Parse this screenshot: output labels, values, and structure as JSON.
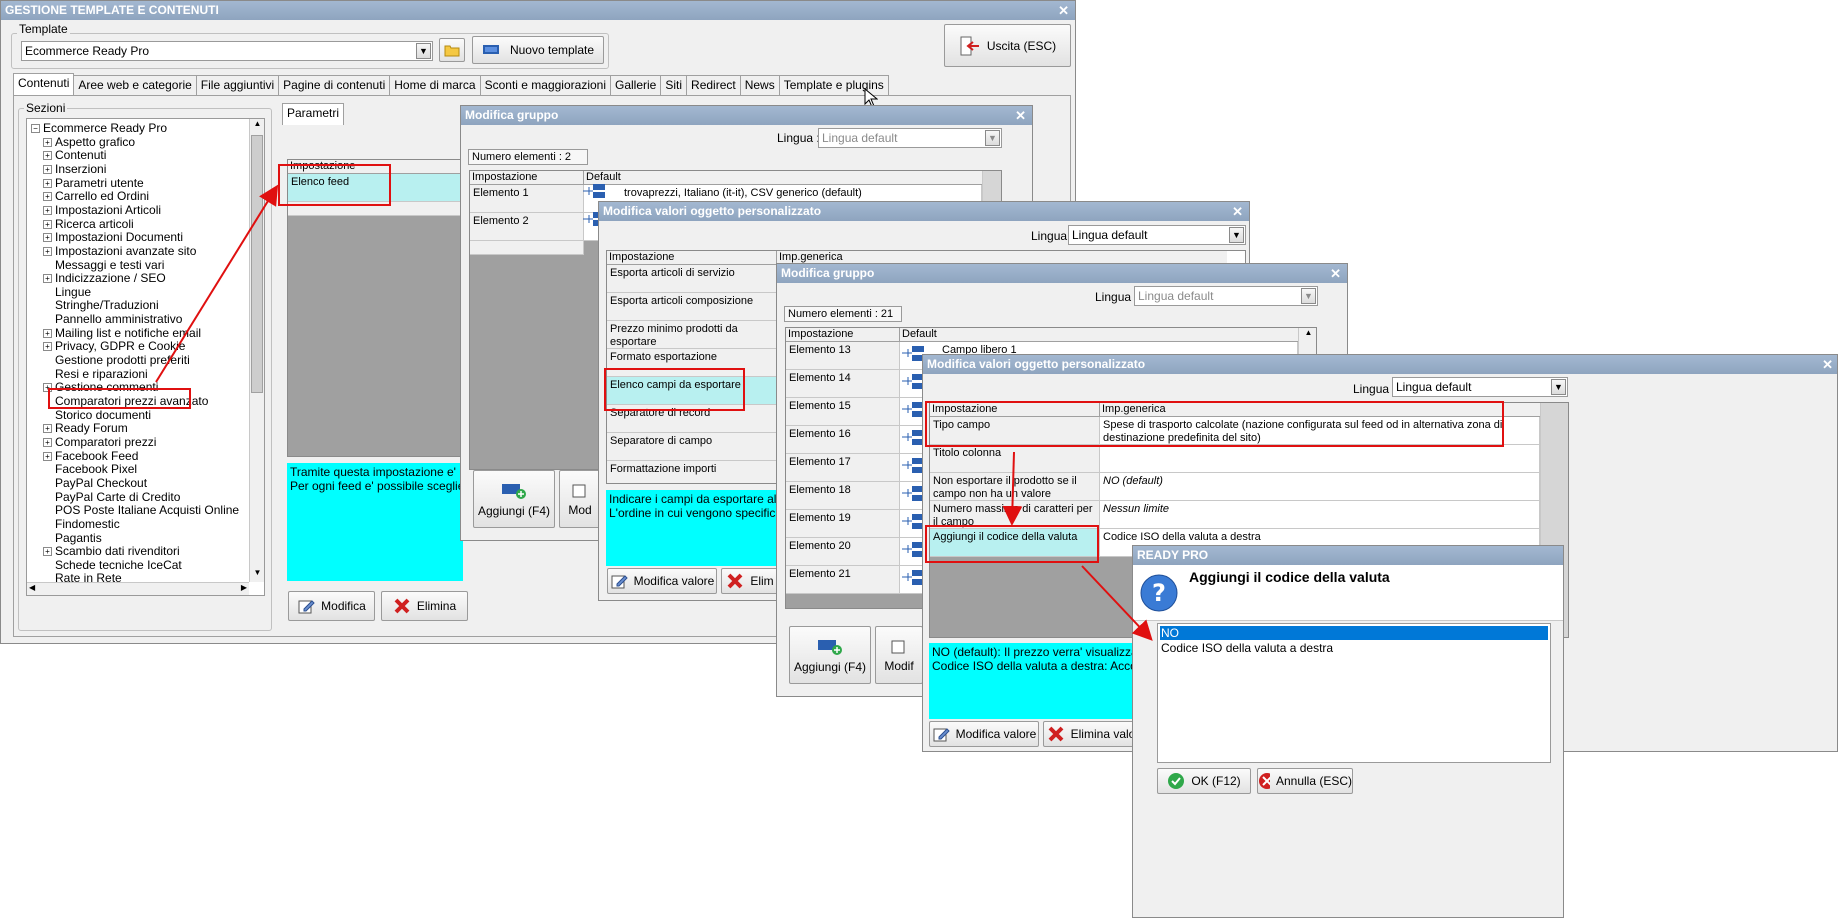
{
  "main_window": {
    "title": "GESTIONE TEMPLATE E CONTENUTI",
    "template_label": "Template",
    "template_value": "Ecommerce Ready Pro",
    "new_template_label": "Nuovo template",
    "exit_label": "Uscita (ESC)",
    "tabs": [
      "Contenuti",
      "Aree web e categorie",
      "File aggiuntivi",
      "Pagine di contenuti",
      "Home di marca",
      "Sconti e maggiorazioni",
      "Gallerie",
      "Siti",
      "Redirect",
      "News",
      "Template e plugins"
    ],
    "sections_label": "Sezioni",
    "tree_root": "Ecommerce Ready Pro",
    "tree_items": [
      {
        "label": "Aspetto grafico",
        "expandable": true
      },
      {
        "label": "Contenuti",
        "expandable": true
      },
      {
        "label": "Inserzioni",
        "expandable": true
      },
      {
        "label": "Parametri utente",
        "expandable": true
      },
      {
        "label": "Carrello ed Ordini",
        "expandable": true
      },
      {
        "label": "Impostazioni Articoli",
        "expandable": true
      },
      {
        "label": "Ricerca articoli",
        "expandable": true
      },
      {
        "label": "Impostazioni Documenti",
        "expandable": true
      },
      {
        "label": "Impostazioni avanzate sito",
        "expandable": true
      },
      {
        "label": "Messaggi e testi vari",
        "expandable": false
      },
      {
        "label": "Indicizzazione / SEO",
        "expandable": true
      },
      {
        "label": "Lingue",
        "expandable": false
      },
      {
        "label": "Stringhe/Traduzioni",
        "expandable": false
      },
      {
        "label": "Pannello amministrativo",
        "expandable": false
      },
      {
        "label": "Mailing list e notifiche email",
        "expandable": true
      },
      {
        "label": "Privacy, GDPR e Cookie",
        "expandable": true
      },
      {
        "label": "Gestione prodotti preferiti",
        "expandable": false
      },
      {
        "label": "Resi e riparazioni",
        "expandable": false
      },
      {
        "label": "Gestione commenti",
        "expandable": true
      },
      {
        "label": "Comparatori prezzi avanzato",
        "expandable": false
      },
      {
        "label": "Storico documenti",
        "expandable": false
      },
      {
        "label": "Ready Forum",
        "expandable": true
      },
      {
        "label": "Comparatori prezzi",
        "expandable": true
      },
      {
        "label": "Facebook Feed",
        "expandable": true
      },
      {
        "label": "Facebook Pixel",
        "expandable": false
      },
      {
        "label": "PayPal Checkout",
        "expandable": false
      },
      {
        "label": "PayPal Carte di Credito",
        "expandable": false
      },
      {
        "label": "POS Poste Italiane Acquisti Online",
        "expandable": false
      },
      {
        "label": "Findomestic",
        "expandable": false
      },
      {
        "label": "Pagantis",
        "expandable": false
      },
      {
        "label": "Scambio dati rivenditori",
        "expandable": true
      },
      {
        "label": "Schede tecniche IceCat",
        "expandable": false
      },
      {
        "label": "Rate in Rete",
        "expandable": false
      }
    ],
    "params_tab": "Parametri",
    "grid_header": "Impostazione",
    "grid_row": "Elenco feed",
    "description": "Tramite questa impostazione e' possi\nPer ogni feed e' possibile scegliere l'e",
    "modify_label": "Modifica",
    "delete_label": "Elimina"
  },
  "group_window_1": {
    "title": "Modifica gruppo",
    "lingua_label": "Lingua :",
    "lingua_value": "Lingua default",
    "count_text": "Numero elementi : 2",
    "col_setting": "Impostazione",
    "col_default": "Default",
    "rows": [
      {
        "label": "Elemento 1",
        "value": "trovaprezzi, Italiano (it-it), CSV generico (default)"
      },
      {
        "label": "Elemento 2",
        "value": ""
      }
    ],
    "add_label": "Aggiungi (F4)",
    "mod_label": "Mod"
  },
  "custom_window_1": {
    "title": "Modifica valori oggetto personalizzato",
    "lingua_label": "Lingua :",
    "lingua_value": "Lingua default",
    "col_setting": "Impostazione",
    "col_value": "Imp.generica",
    "rows": [
      "Esporta articoli di servizio",
      "Esporta articoli composizione",
      "Prezzo minimo prodotti da esportare",
      "Formato esportazione",
      "Elenco campi da esportare",
      "Separatore di record",
      "Separatore di campo",
      "Formattazione importi"
    ],
    "description": "Indicare i campi da esportare all'interno d\nL'ordine in cui vengono specificati corrispo",
    "modify_value_label": "Modifica valore",
    "delete_label": "Elim"
  },
  "group_window_2": {
    "title": "Modifica gruppo",
    "lingua_label": "Lingua :",
    "lingua_value": "Lingua default",
    "count_text": "Numero elementi : 21",
    "col_setting": "Impostazione",
    "col_default": "Default",
    "rows": [
      {
        "label": "Elemento 13",
        "value": "Campo libero 1"
      },
      {
        "label": "Elemento 14",
        "value": ""
      },
      {
        "label": "Elemento 15",
        "value": ""
      },
      {
        "label": "Elemento 16",
        "value": ""
      },
      {
        "label": "Elemento 17",
        "value": ""
      },
      {
        "label": "Elemento 18",
        "value": ""
      },
      {
        "label": "Elemento 19",
        "value": ""
      },
      {
        "label": "Elemento 20",
        "value": ""
      },
      {
        "label": "Elemento 21",
        "value": ""
      }
    ],
    "add_label": "Aggiungi (F4)",
    "mod_label": "Modif"
  },
  "custom_window_2": {
    "title": "Modifica valori oggetto personalizzato",
    "lingua_label": "Lingua :",
    "lingua_value": "Lingua default",
    "col_setting": "Impostazione",
    "col_value": "Imp.generica",
    "rows": [
      {
        "label": "Tipo campo",
        "value": "Spese di trasporto calcolate (nazione configurata sul feed od in alternativa zona di destinazione predefinita del sito)"
      },
      {
        "label": "Titolo colonna",
        "value": ""
      },
      {
        "label": "Non esportare il prodotto se il campo non ha un valore",
        "value": "NO (default)"
      },
      {
        "label": "Numero massimo di caratteri per il campo",
        "value": "Nessun limite"
      },
      {
        "label": "Aggiungi il codice della valuta",
        "value": "Codice ISO della valuta a destra"
      }
    ],
    "description": "NO (default): Il prezzo verra' visualizzato senza il\nCodice ISO della valuta a destra: Accoda al prezzo",
    "modify_value_label": "Modifica valore",
    "delete_label": "Elimina valo"
  },
  "dialog": {
    "title": "READY PRO",
    "question": "Aggiungi il codice della valuta",
    "options": [
      "NO",
      "Codice ISO della valuta a destra"
    ],
    "selected_index": 0,
    "ok_label": "OK (F12)",
    "cancel_label": "Annulla (ESC)"
  },
  "colors": {
    "titlebar": "#8ea4bf",
    "description_bg": "#00ffff",
    "selected_cell": "#b8f0f0",
    "selection": "#0078d7",
    "highlight_box": "#e01010"
  }
}
